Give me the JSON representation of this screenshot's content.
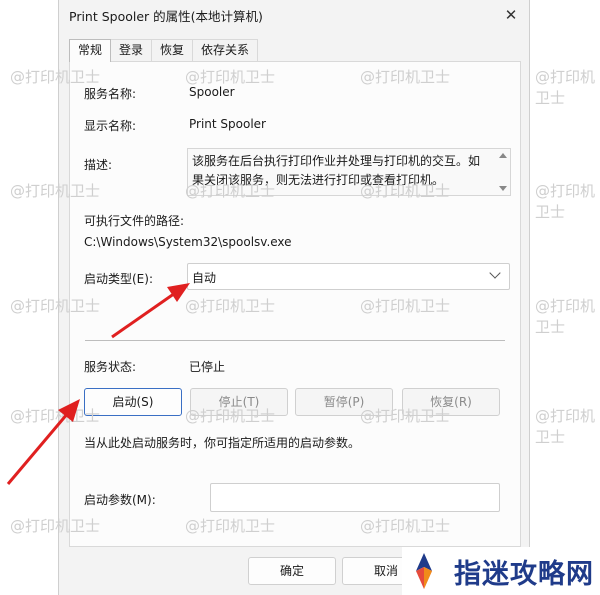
{
  "window": {
    "title": "Print Spooler 的属性(本地计算机)",
    "close_glyph": "✕"
  },
  "tabs": [
    {
      "label": "常规",
      "active": true
    },
    {
      "label": "登录",
      "active": false
    },
    {
      "label": "恢复",
      "active": false
    },
    {
      "label": "依存关系",
      "active": false
    }
  ],
  "general": {
    "service_name_label": "服务名称:",
    "service_name_value": "Spooler",
    "display_name_label": "显示名称:",
    "display_name_value": "Print Spooler",
    "description_label": "描述:",
    "description_value": "该服务在后台执行打印作业并处理与打印机的交互。如果关闭该服务，则无法进行打印或查看打印机。",
    "exe_path_label": "可执行文件的路径:",
    "exe_path_value": "C:\\Windows\\System32\\spoolsv.exe",
    "startup_type_label": "启动类型(E):",
    "startup_type_value": "自动",
    "status_label": "服务状态:",
    "status_value": "已停止",
    "buttons": {
      "start": "启动(S)",
      "stop": "停止(T)",
      "pause": "暂停(P)",
      "resume": "恢复(R)"
    },
    "hint": "当从此处启动服务时，你可指定所适用的启动参数。",
    "start_params_label": "启动参数(M):",
    "start_params_value": ""
  },
  "footer": {
    "ok": "确定",
    "cancel": "取消"
  },
  "watermark": "@打印机卫士",
  "brand": {
    "text": "指迷攻略网"
  },
  "colors": {
    "arrow": "#e02020",
    "primary_border": "#3a6fc4",
    "brand": "#1f3b8a"
  }
}
